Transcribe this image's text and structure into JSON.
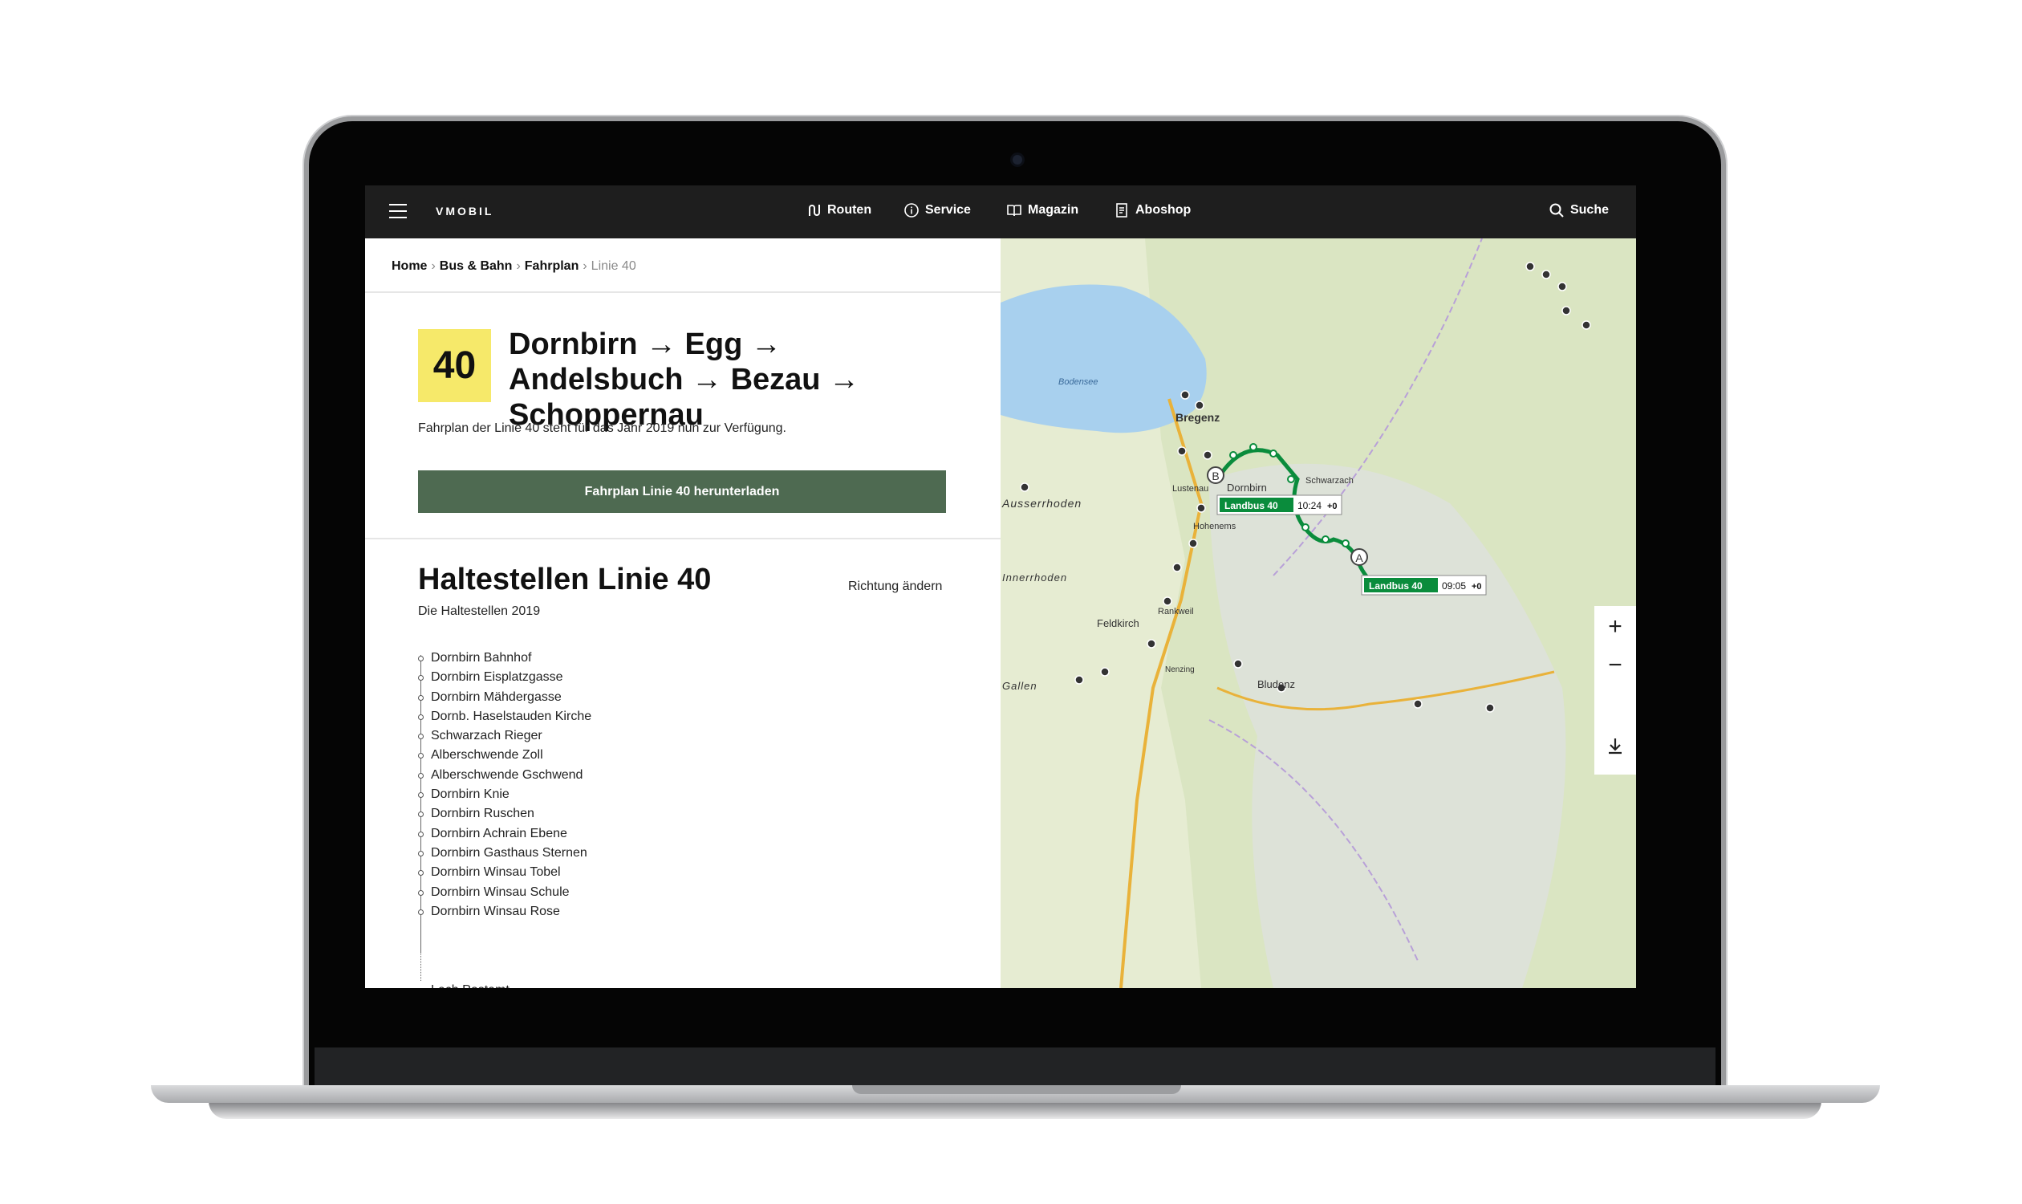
{
  "header": {
    "logo": "VMOBIL",
    "nav": [
      {
        "label": "Routen",
        "icon": "route-icon"
      },
      {
        "label": "Service",
        "icon": "info-icon"
      },
      {
        "label": "Magazin",
        "icon": "book-icon"
      },
      {
        "label": "Aboshop",
        "icon": "document-icon"
      }
    ],
    "search_label": "Suche"
  },
  "breadcrumb": [
    "Home",
    "Bus & Bahn",
    "Fahrplan",
    "Linie 40"
  ],
  "line": {
    "number": "40",
    "title": "Dornbirn → Egg → Andelsbuch → Bezau → Schoppernau",
    "subtitle": "Fahrplan der Linie 40 steht für das Jahr 2019 nun zur Verfügung.",
    "download_label": "Fahrplan Linie 40 herunterladen"
  },
  "stops_section": {
    "title": "Haltestellen Linie 40",
    "subtitle": "Die Haltestellen 2019",
    "direction_label": "Richtung ändern",
    "stops": [
      "Dornbirn Bahnhof",
      "Dornbirn Eisplatzgasse",
      "Dornbirn Mähdergasse",
      "Dornb. Haselstauden Kirche",
      "Schwarzach Rieger",
      "Alberschwende Zoll",
      "Alberschwende Gschwend",
      "Dornbirn Knie",
      "Dornbirn Ruschen",
      "Dornbirn Achrain Ebene",
      "Dornbirn Gasthaus Sternen",
      "Dornbirn Winsau Tobel",
      "Dornbirn Winsau Schule",
      "Dornbirn Winsau Rose"
    ],
    "last_stop": "Lech Postamt"
  },
  "map": {
    "labels": {
      "lake": "Bodensee",
      "bregenz": "Bregenz",
      "dornbirn": "Dornbirn",
      "lustenau": "Lustenau",
      "hohenems": "Hohenems",
      "feldkirch": "Feldkirch",
      "bludenz": "Bludenz",
      "ausserrhoden": "Ausserrhoden",
      "innerrhoden": "Innerrhoden",
      "gallen": "Gallen",
      "schwarzach": "Schwarzach",
      "rankweil": "Rankweil",
      "nenzing": "Nenzing"
    },
    "markers": {
      "a": "A",
      "b": "B"
    },
    "bus_labels": [
      {
        "bus": "Landbus 40",
        "time": "10:24",
        "delay": "+0"
      },
      {
        "bus": "Landbus 40",
        "time": "09:05",
        "delay": "+0"
      }
    ],
    "colors": {
      "route": "#0a8c3c",
      "water": "#a8d0ee",
      "forest": "#c8deb0",
      "mountain": "#d8ddd4"
    }
  }
}
